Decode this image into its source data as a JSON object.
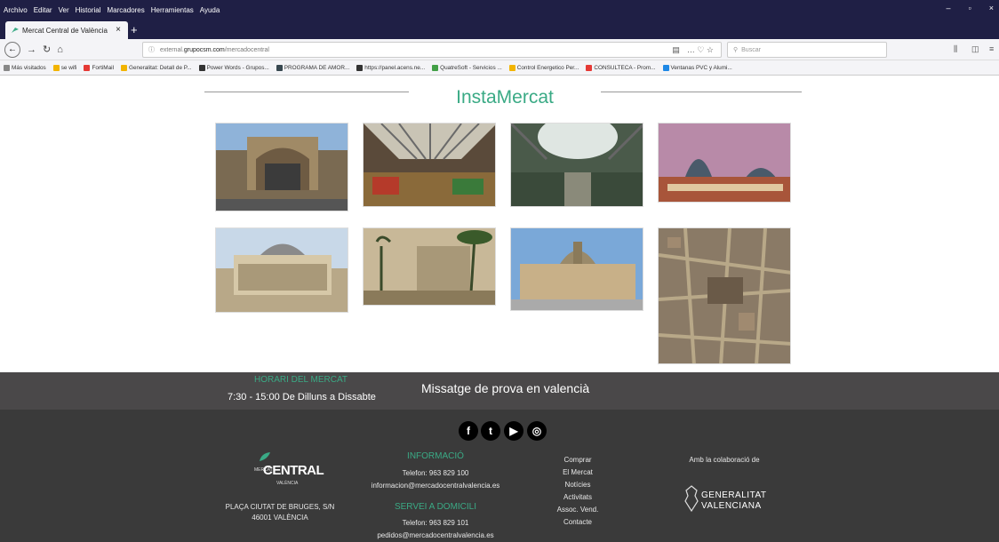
{
  "menu": [
    "Archivo",
    "Editar",
    "Ver",
    "Historial",
    "Marcadores",
    "Herramientas",
    "Ayuda"
  ],
  "tab": {
    "title": "Mercat Central de València",
    "close": "×",
    "new": "+"
  },
  "nav": {
    "url_prefix": "external.",
    "url_domain": "grupocsm.com",
    "url_path": "/mercadocentral",
    "search_placeholder": "Buscar",
    "url_icons": "… ♡ ☆"
  },
  "bookmarks": [
    {
      "label": "Más visitados",
      "color": "#888"
    },
    {
      "label": "se wifi",
      "color": "#f2b400"
    },
    {
      "label": "FortiMail",
      "color": "#e53935"
    },
    {
      "label": "Generalitat: Detall de P...",
      "color": "#f2b400"
    },
    {
      "label": "Power Words - Grupos...",
      "color": "#333"
    },
    {
      "label": "PROGRAMA DE AMOR...",
      "color": "#37474f"
    },
    {
      "label": "https://panel.acens.ne...",
      "color": "#333"
    },
    {
      "label": "QuatreSoft - Servicios ...",
      "color": "#43a047"
    },
    {
      "label": "Control Energetico Per...",
      "color": "#f2b400"
    },
    {
      "label": "CONSULTECA - Prom...",
      "color": "#e53935"
    },
    {
      "label": "Ventanas PVC y Alumi...",
      "color": "#1e88e5"
    }
  ],
  "page": {
    "title": "InstaMercat"
  },
  "horari": {
    "title": "HORARI DEL MERCAT",
    "text": "7:30 - 15:00  De Dilluns a Dissabte"
  },
  "missatge": "Missatge de prova en valencià",
  "social": [
    "f",
    "t",
    "▶",
    "◎"
  ],
  "footer": {
    "logo_small": "MERCAT",
    "logo_main": "CENTRAL",
    "logo_sub": "VALÈNCIA",
    "address1": "PLAÇA CIUTAT DE BRUGES, S/N",
    "address2": "46001 VALÈNCIA",
    "info_title": "INFORMACIÓ",
    "info_phone": "Telefon: 963 829 100",
    "info_email": "informacion@mercadocentralvalencia.es",
    "servei_title": "SERVEI A DOMICILI",
    "servei_phone": "Telefon: 963 829 101",
    "servei_email": "pedidos@mercadocentralvalencia.es",
    "links": [
      "Comprar",
      "El Mercat",
      "Notícies",
      "Activitats",
      "Assoc. Vend.",
      "Contacte"
    ],
    "collab": "Amb la colaboració de",
    "gv1": "GENERALITAT",
    "gv2": "VALENCIANA"
  },
  "colors": {
    "accent": "#3aaa85",
    "band": "#4a4849",
    "footer": "#3a3a3a",
    "chrome": "#1f1f45"
  }
}
